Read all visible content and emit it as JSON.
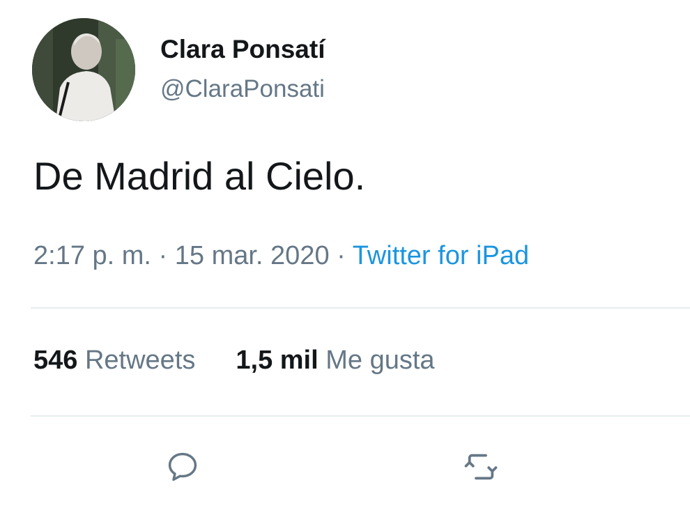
{
  "user": {
    "display_name": "Clara Ponsatí",
    "handle": "@ClaraPonsati"
  },
  "tweet": {
    "text": "De Madrid al Cielo.",
    "time": "2:17 p. m.",
    "separator": "·",
    "date": "15 mar. 2020",
    "source": "Twitter for iPad"
  },
  "stats": {
    "retweets_count": "546",
    "retweets_label": "Retweets",
    "likes_count": "1,5 mil",
    "likes_label": "Me gusta"
  },
  "actions": {
    "reply_icon": "reply-icon",
    "retweet_icon": "retweet-icon"
  },
  "colors": {
    "text": "#14171a",
    "secondary": "#657786",
    "link": "#1b95e0",
    "divider": "#e6ecf0"
  }
}
